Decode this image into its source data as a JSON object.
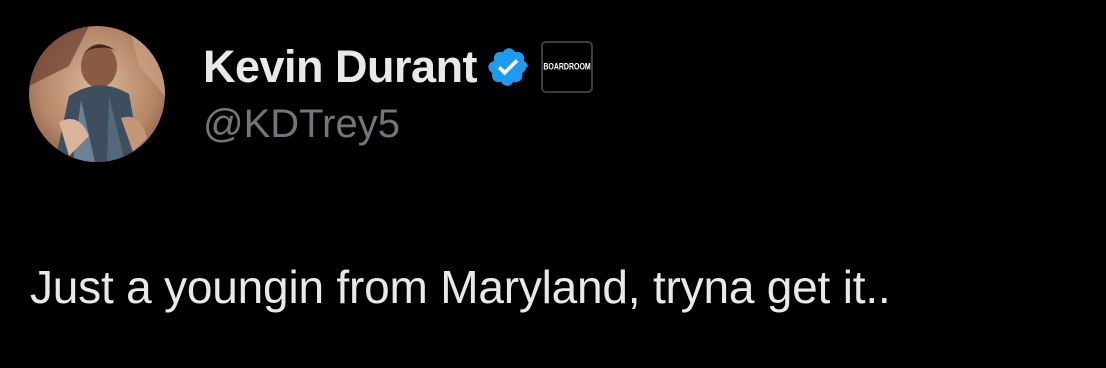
{
  "tweet": {
    "author": {
      "display_name": "Kevin Durant",
      "handle": "@KDTrey5",
      "verified": true,
      "avatar": "avatar-photo",
      "affiliate_badge": {
        "label": "BOARDROOM",
        "icon": "boardroom-logo-icon"
      }
    },
    "text": "Just a youngin from Maryland, tryna get it.."
  },
  "colors": {
    "background": "#000000",
    "text_primary": "#e7e9ea",
    "text_secondary": "#71767b",
    "verified_badge": "#1d9bf0"
  }
}
